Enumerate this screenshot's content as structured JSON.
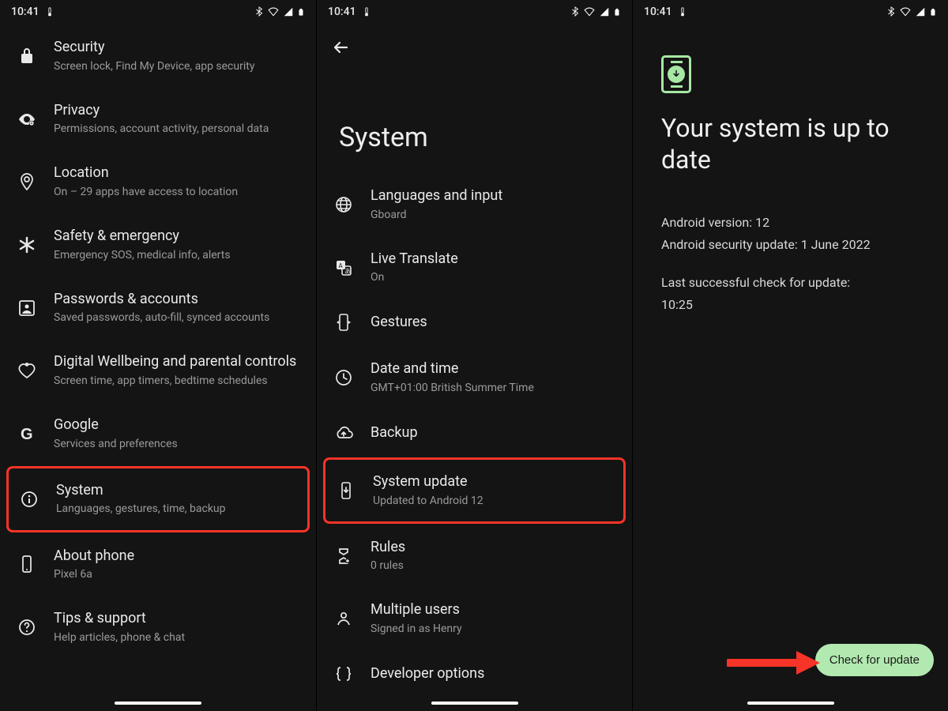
{
  "status": {
    "time": "10:41",
    "bluetooth": true,
    "wifi": true,
    "signal": true,
    "battery": true
  },
  "accent": "#b2e9b0",
  "annotation_highlight_color": "#f63427",
  "panel1": {
    "items": [
      {
        "icon": "lock",
        "title": "Security",
        "sub": "Screen lock, Find My Device, app security"
      },
      {
        "icon": "eye",
        "title": "Privacy",
        "sub": "Permissions, account activity, personal data"
      },
      {
        "icon": "pin",
        "title": "Location",
        "sub": "On – 29 apps have access to location"
      },
      {
        "icon": "asterisk",
        "title": "Safety & emergency",
        "sub": "Emergency SOS, medical info, alerts"
      },
      {
        "icon": "account-box",
        "title": "Passwords & accounts",
        "sub": "Saved passwords, auto-fill, synced accounts"
      },
      {
        "icon": "heart",
        "title": "Digital Wellbeing and parental controls",
        "sub": "Screen time, app timers, bedtime schedules"
      },
      {
        "icon": "google",
        "title": "Google",
        "sub": "Services and preferences"
      },
      {
        "icon": "info",
        "title": "System",
        "sub": "Languages, gestures, time, backup",
        "highlight": true
      },
      {
        "icon": "phone-a",
        "title": "About phone",
        "sub": "Pixel 6a"
      },
      {
        "icon": "help",
        "title": "Tips & support",
        "sub": "Help articles, phone & chat"
      }
    ]
  },
  "panel2": {
    "title": "System",
    "items": [
      {
        "icon": "globe",
        "title": "Languages and input",
        "sub": "Gboard"
      },
      {
        "icon": "translate",
        "title": "Live Translate",
        "sub": "On"
      },
      {
        "icon": "gesture",
        "title": "Gestures",
        "sub": ""
      },
      {
        "icon": "clock",
        "title": "Date and time",
        "sub": "GMT+01:00 British Summer Time"
      },
      {
        "icon": "cloud-up",
        "title": "Backup",
        "sub": ""
      },
      {
        "icon": "phone-down",
        "title": "System update",
        "sub": "Updated to Android 12",
        "highlight": true
      },
      {
        "icon": "rules",
        "title": "Rules",
        "sub": "0 rules"
      },
      {
        "icon": "person",
        "title": "Multiple users",
        "sub": "Signed in as Henry"
      },
      {
        "icon": "braces",
        "title": "Developer options",
        "sub": ""
      }
    ]
  },
  "panel3": {
    "heading": "Your system is up to date",
    "android_version_label": "Android version: 12",
    "security_update_label": "Android security update: 1 June 2022",
    "last_check_label": "Last successful check for update:",
    "last_check_time": "10:25",
    "check_button": "Check for update"
  }
}
